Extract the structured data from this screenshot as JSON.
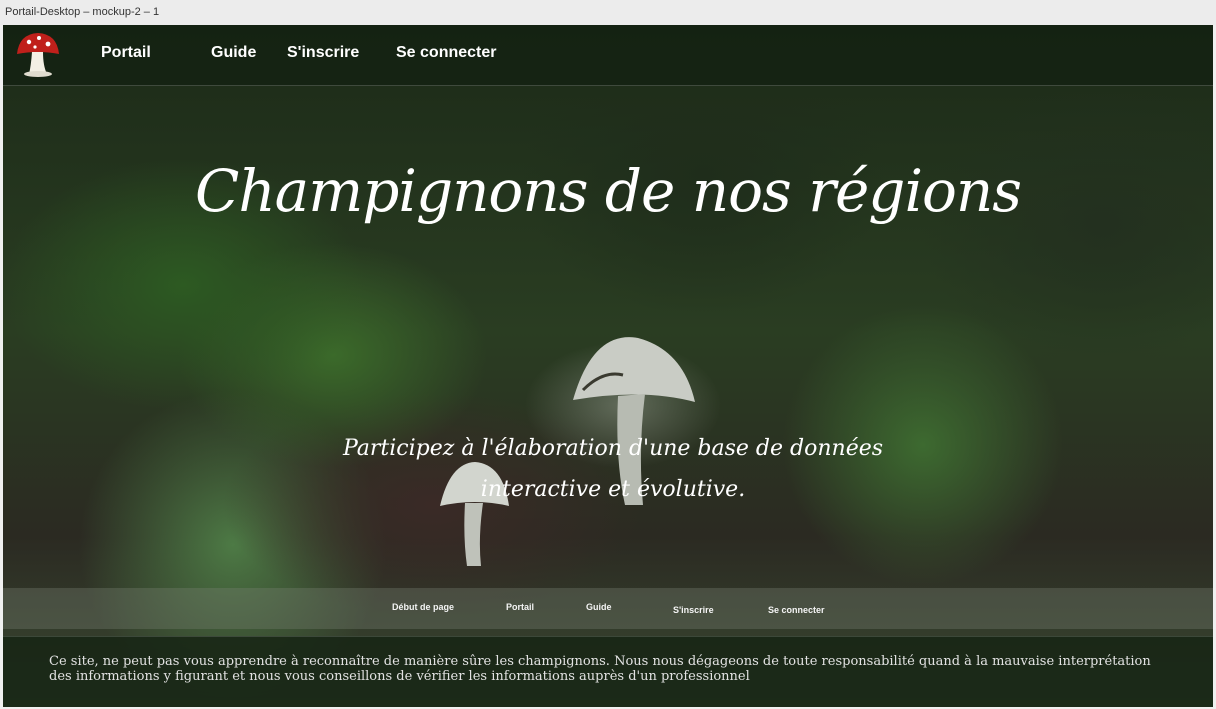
{
  "window": {
    "title": "Portail-Desktop – mockup-2 – 1"
  },
  "nav": {
    "logo_icon": "amanita-mushroom-icon",
    "items": [
      {
        "label": "Portail"
      },
      {
        "label": "Guide"
      },
      {
        "label": "S'inscrire"
      },
      {
        "label": "Se connecter"
      }
    ]
  },
  "hero": {
    "title": "Champignons de nos régions",
    "subtitle": "Participez à l'élaboration d'une base de données interactive et évolutive."
  },
  "footer_nav": {
    "items": [
      {
        "label": "Début de page"
      },
      {
        "label": "Portail"
      },
      {
        "label": "Guide"
      },
      {
        "label": "S'inscrire"
      },
      {
        "label": "Se connecter"
      }
    ]
  },
  "disclaimer": {
    "text": "Ce site, ne peut pas vous apprendre à reconnaître de manière sûre les champignons. Nous nous dégageons de toute responsabilité quand à la mauvaise interprétation des informations y figurant et nous vous conseillons de vérifier les informations auprès d'un professionnel"
  },
  "colors": {
    "nav_bg": "#122010",
    "text": "#ffffff",
    "logo_cap": "#c0201b"
  }
}
